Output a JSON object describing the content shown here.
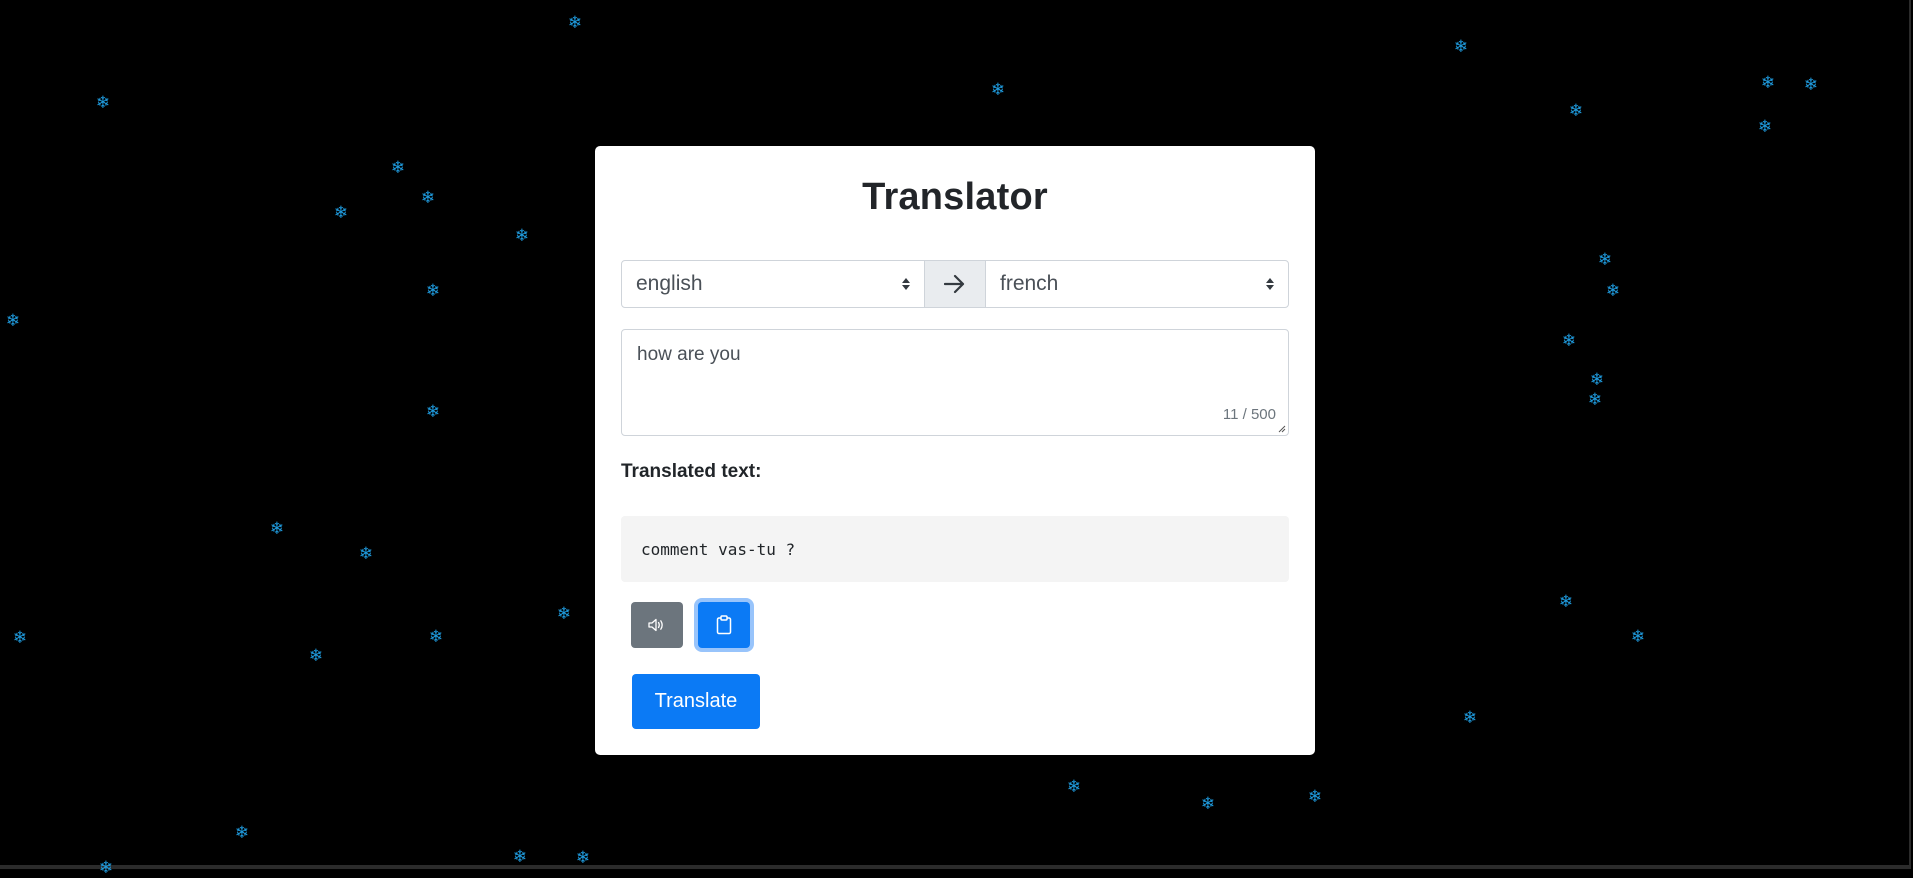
{
  "app": {
    "title": "Translator"
  },
  "languages": {
    "from_selected": "english",
    "to_selected": "french",
    "swap_icon": "arrow-right-icon"
  },
  "source": {
    "text": "how are you",
    "char_count": "11 / 500"
  },
  "output": {
    "label": "Translated text:",
    "text": "comment vas-tu ?"
  },
  "actions": {
    "speak_icon": "speaker-icon",
    "copy_icon": "clipboard-icon",
    "translate_label": "Translate"
  },
  "decor": {
    "snowflake_glyph": "❄"
  },
  "colors": {
    "primary": "#0b7af5",
    "secondary": "#6c757d",
    "snowflake": "#1f9bde",
    "background": "#000000"
  }
}
